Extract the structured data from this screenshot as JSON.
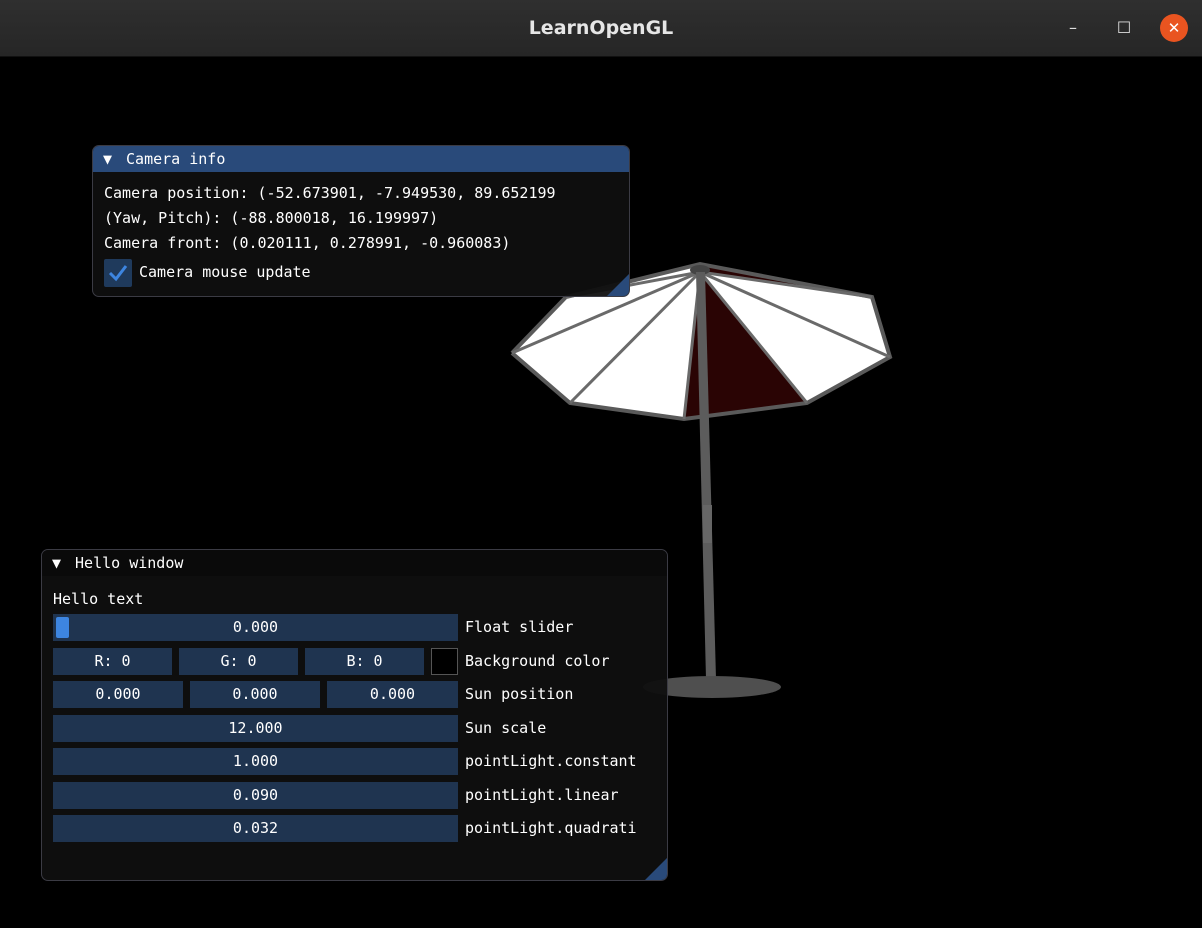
{
  "window": {
    "title": "LearnOpenGL",
    "minimize_icon": "minimize-icon",
    "maximize_icon": "maximize-icon",
    "close_icon": "close-icon"
  },
  "camera_panel": {
    "title": "Camera info",
    "position_text": "Camera position: (-52.673901, -7.949530, 89.652199",
    "yaw_pitch_text": "(Yaw, Pitch): (-88.800018, 16.199997)",
    "front_text": "Camera front: (0.020111, 0.278991, -0.960083)",
    "mouse_update_label": "Camera mouse update",
    "mouse_update_checked": true
  },
  "hello_panel": {
    "title": "Hello window",
    "hello_text": "Hello text",
    "float_slider": {
      "value": "0.000",
      "label": "Float slider"
    },
    "background_color": {
      "r": "R:  0",
      "g": "G:  0",
      "b": "B:  0",
      "label": "Background color",
      "swatch": "#000000"
    },
    "sun_position": {
      "x": "0.000",
      "y": "0.000",
      "z": "0.000",
      "label": "Sun position"
    },
    "sun_scale": {
      "value": "12.000",
      "label": "Sun scale"
    },
    "point_constant": {
      "value": "1.000",
      "label": "pointLight.constant"
    },
    "point_linear": {
      "value": "0.090",
      "label": "pointLight.linear"
    },
    "point_quadratic": {
      "value": "0.032",
      "label": "pointLight.quadrati"
    }
  },
  "colors": {
    "title_active": "#294a7a",
    "frame_bg": "#1f3450",
    "slider_grab": "#3d85e0",
    "close_button": "#e95420",
    "umbrella_red": "#2a0404"
  }
}
